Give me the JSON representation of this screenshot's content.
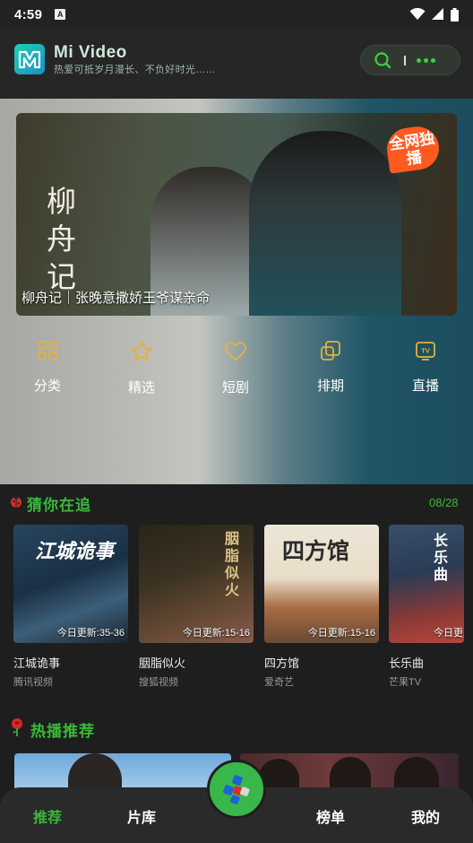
{
  "status_bar": {
    "time": "4:59",
    "notification_letter": "A"
  },
  "header": {
    "app_name": "Mi Video",
    "slogan": "热爱可抵岁月漫长、不负好时光……"
  },
  "banner": {
    "calligraphy": "柳舟记",
    "badge": "全网独播",
    "caption": "柳舟记｜张晚意撒娇王爷谋亲命"
  },
  "quick_nav": [
    {
      "label": "分类",
      "icon": "grid-icon"
    },
    {
      "label": "精选",
      "icon": "star-icon"
    },
    {
      "label": "短剧",
      "icon": "heart-icon"
    },
    {
      "label": "排期",
      "icon": "schedule-icon"
    },
    {
      "label": "直播",
      "icon": "tv-icon"
    }
  ],
  "following": {
    "title": "猜你在追",
    "date": "08/28",
    "items": [
      {
        "name": "江城诡事",
        "source": "腾讯视频",
        "update": "今日更新:35-36",
        "poster_text": "江城诡事"
      },
      {
        "name": "胭脂似火",
        "source": "搜狐视频",
        "update": "今日更新:15-16",
        "poster_text": "胭脂似火"
      },
      {
        "name": "四方馆",
        "source": "爱奇艺",
        "update": "今日更新:15-16",
        "poster_text": "四方馆"
      },
      {
        "name": "长乐曲",
        "source": "芒果TV",
        "update": "今日更",
        "poster_text": "长乐曲"
      }
    ]
  },
  "hot": {
    "title": "热播推荐"
  },
  "bottom_nav": {
    "items": [
      {
        "label": "推荐"
      },
      {
        "label": "片库"
      },
      {
        "label": "榜单"
      },
      {
        "label": "我的"
      }
    ]
  },
  "colors": {
    "accent": "#3ab83a",
    "icon_yellow": "#e3b23c",
    "background": "#1e1e1e"
  }
}
